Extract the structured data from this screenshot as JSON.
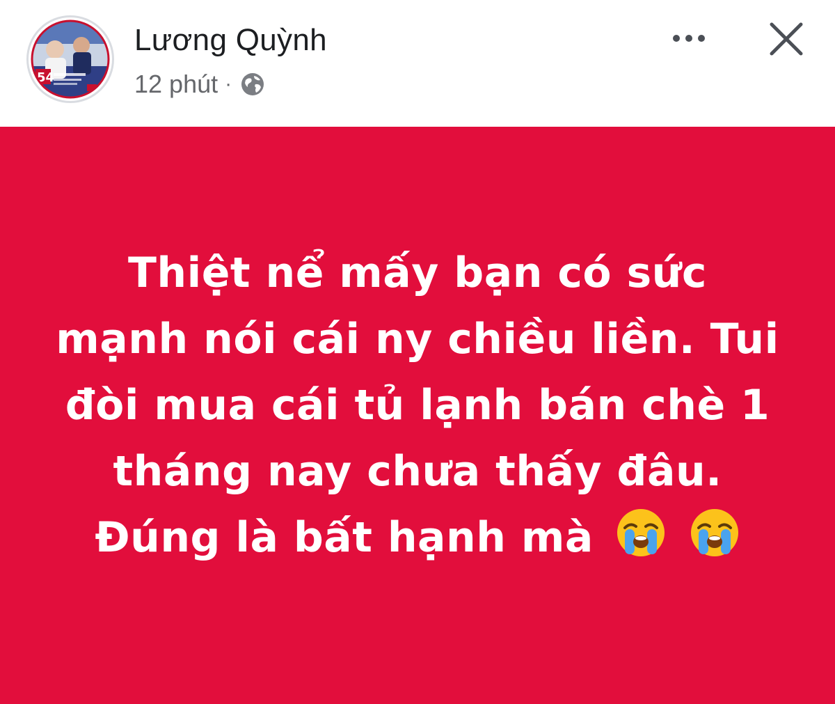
{
  "post": {
    "author_name": "Lương Quỳnh",
    "timestamp": "12 phút",
    "separator": "·",
    "audience_icon": "globe-icon",
    "more_icon": "more-options-icon",
    "close_icon": "close-icon",
    "background_color": "#e20e3c",
    "text_color": "#ffffff",
    "status_text": "Thiệt nể mấy bạn có sức mạnh nói cái ny chiều liền. Tui đòi mua cái tủ lạnh bán chè 1 tháng nay chưa thấy đâu. Đúng là bất hạnh mà",
    "emojis": [
      "loudly-crying-face-icon",
      "loudly-crying-face-icon"
    ]
  }
}
